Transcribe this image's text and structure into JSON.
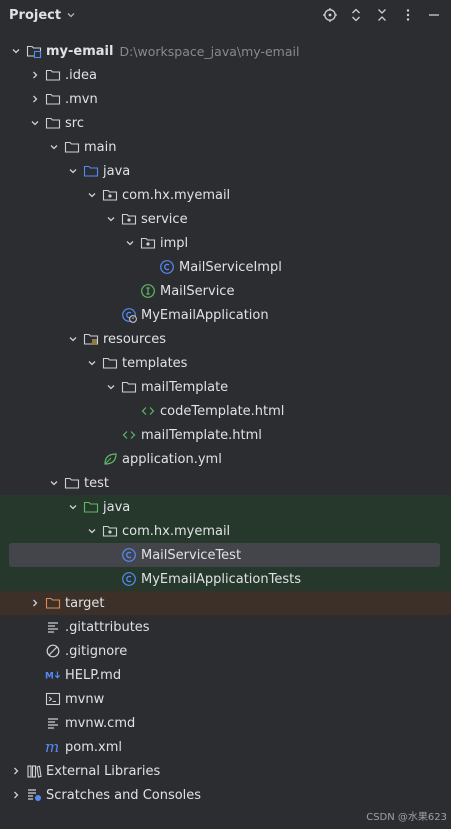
{
  "header": {
    "title": "Project"
  },
  "tree": [
    {
      "label": "my-email",
      "path": "D:\\workspace_java\\my-email",
      "icon": "module-folder-icon",
      "indent": 0,
      "arrow": "down",
      "bold": true
    },
    {
      "label": ".idea",
      "icon": "folder-icon",
      "indent": 1,
      "arrow": "right"
    },
    {
      "label": ".mvn",
      "icon": "folder-icon",
      "indent": 1,
      "arrow": "right"
    },
    {
      "label": "src",
      "icon": "folder-icon",
      "indent": 1,
      "arrow": "down"
    },
    {
      "label": "main",
      "icon": "folder-icon",
      "indent": 2,
      "arrow": "down"
    },
    {
      "label": "java",
      "icon": "source-folder-icon",
      "indent": 3,
      "arrow": "down"
    },
    {
      "label": "com.hx.myemail",
      "icon": "package-icon",
      "indent": 4,
      "arrow": "down"
    },
    {
      "label": "service",
      "icon": "package-icon",
      "indent": 5,
      "arrow": "down"
    },
    {
      "label": "impl",
      "icon": "package-icon",
      "indent": 6,
      "arrow": "down"
    },
    {
      "label": "MailServiceImpl",
      "icon": "class-icon",
      "indent": 7,
      "arrow": "none"
    },
    {
      "label": "MailService",
      "icon": "interface-icon",
      "indent": 6,
      "arrow": "none"
    },
    {
      "label": "MyEmailApplication",
      "icon": "spring-class-icon",
      "indent": 5,
      "arrow": "none"
    },
    {
      "label": "resources",
      "icon": "resources-folder-icon",
      "indent": 3,
      "arrow": "down"
    },
    {
      "label": "templates",
      "icon": "folder-icon",
      "indent": 4,
      "arrow": "down"
    },
    {
      "label": "mailTemplate",
      "icon": "folder-icon",
      "indent": 5,
      "arrow": "down"
    },
    {
      "label": "codeTemplate.html",
      "icon": "html-icon",
      "indent": 6,
      "arrow": "none"
    },
    {
      "label": "mailTemplate.html",
      "icon": "html-icon",
      "indent": 5,
      "arrow": "none"
    },
    {
      "label": "application.yml",
      "icon": "spring-leaf-icon",
      "indent": 4,
      "arrow": "none"
    },
    {
      "label": "test",
      "icon": "folder-icon",
      "indent": 2,
      "arrow": "down"
    },
    {
      "label": "java",
      "icon": "test-folder-icon",
      "indent": 3,
      "arrow": "down",
      "bg": "test"
    },
    {
      "label": "com.hx.myemail",
      "icon": "package-icon",
      "indent": 4,
      "arrow": "down",
      "bg": "test"
    },
    {
      "label": "MailServiceTest",
      "icon": "class-icon",
      "indent": 5,
      "arrow": "none",
      "bg": "test",
      "selected": true
    },
    {
      "label": "MyEmailApplicationTests",
      "icon": "class-icon",
      "indent": 5,
      "arrow": "none",
      "bg": "test"
    },
    {
      "label": "target",
      "icon": "excluded-folder-icon",
      "indent": 1,
      "arrow": "right",
      "bg": "excluded"
    },
    {
      "label": ".gitattributes",
      "icon": "text-lines-icon",
      "indent": 1,
      "arrow": "none"
    },
    {
      "label": ".gitignore",
      "icon": "ignore-icon",
      "indent": 1,
      "arrow": "none"
    },
    {
      "label": "HELP.md",
      "icon": "markdown-icon",
      "indent": 1,
      "arrow": "none"
    },
    {
      "label": "mvnw",
      "icon": "terminal-icon",
      "indent": 1,
      "arrow": "none"
    },
    {
      "label": "mvnw.cmd",
      "icon": "text-lines-icon",
      "indent": 1,
      "arrow": "none"
    },
    {
      "label": "pom.xml",
      "icon": "maven-icon",
      "indent": 1,
      "arrow": "none"
    },
    {
      "label": "External Libraries",
      "icon": "libraries-icon",
      "indent": 0,
      "arrow": "right"
    },
    {
      "label": "Scratches and Consoles",
      "icon": "scratches-icon",
      "indent": 0,
      "arrow": "right"
    }
  ],
  "watermark": "CSDN @水果623"
}
